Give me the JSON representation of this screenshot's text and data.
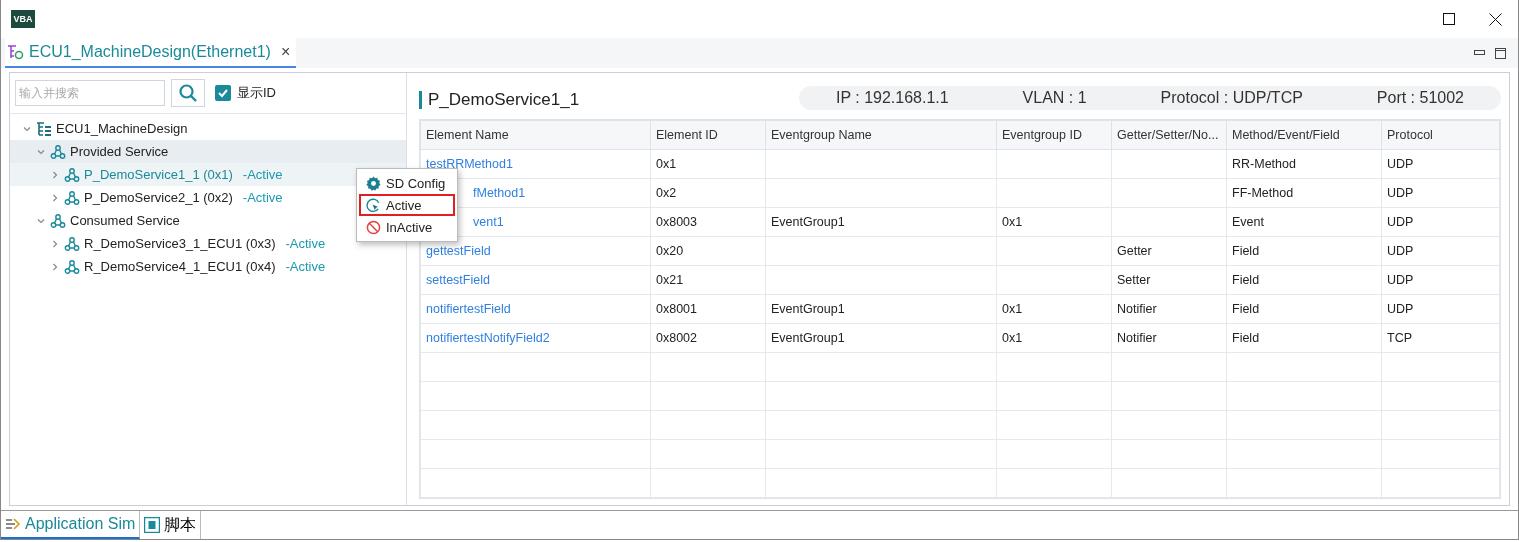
{
  "window": {
    "logo": "VBA"
  },
  "editor_tab": {
    "label": "ECU1_MachineDesign(Ethernet1)",
    "close": "×"
  },
  "search": {
    "placeholder": "输入并搜索"
  },
  "show_id": {
    "label": "显示ID",
    "checked": true
  },
  "tree": [
    {
      "label": "ECU1_MachineDesign",
      "kind": "root",
      "expanded": true,
      "selected": false,
      "highlighted": false,
      "children": [
        {
          "label": "Provided Service",
          "expanded": true,
          "selected": false,
          "highlighted": true,
          "children": [
            {
              "label": "P_DemoService1_1 (0x1)",
              "status": "-Active",
              "expanded": false,
              "selected": true,
              "highlighted": false
            },
            {
              "label": "P_DemoService2_1 (0x2)",
              "status": "-Active",
              "expanded": false,
              "selected": false,
              "highlighted": false
            }
          ]
        },
        {
          "label": "Consumed Service",
          "expanded": true,
          "selected": false,
          "highlighted": false,
          "children": [
            {
              "label": "R_DemoService3_1_ECU1 (0x3)",
              "status": "-Active",
              "expanded": false,
              "selected": false,
              "highlighted": false
            },
            {
              "label": "R_DemoService4_1_ECU1 (0x4)",
              "status": "-Active",
              "expanded": false,
              "selected": false,
              "highlighted": false
            }
          ]
        }
      ]
    }
  ],
  "context_menu": [
    {
      "label": "SD Config",
      "kind": "config",
      "highlighted": false
    },
    {
      "label": "Active",
      "kind": "active",
      "highlighted": true
    },
    {
      "label": "InActive",
      "kind": "inactive",
      "highlighted": false
    }
  ],
  "detail": {
    "title": "P_DemoService1_1",
    "ip": "IP : 192.168.1.1",
    "vlan": "VLAN : 1",
    "protocol": "Protocol : UDP/TCP",
    "port": "Port : 51002"
  },
  "table": {
    "columns": [
      "Element Name",
      "Element ID",
      "Eventgroup Name",
      "Eventgroup ID",
      "Getter/Setter/No...",
      "Method/Event/Field",
      "Protocol"
    ],
    "rows": [
      {
        "covered": false,
        "cells": [
          "testRRMethod1",
          "0x1",
          "",
          "",
          "",
          "RR-Method",
          "UDP"
        ]
      },
      {
        "covered": true,
        "cells": [
          "fMethod1",
          "0x2",
          "",
          "",
          "",
          "FF-Method",
          "UDP"
        ]
      },
      {
        "covered": true,
        "cells": [
          "vent1",
          "0x8003",
          "EventGroup1",
          "0x1",
          "",
          "Event",
          "UDP"
        ]
      },
      {
        "covered": false,
        "cells": [
          "gettestField",
          "0x20",
          "",
          "",
          "Getter",
          "Field",
          "UDP"
        ]
      },
      {
        "covered": false,
        "cells": [
          "settestField",
          "0x21",
          "",
          "",
          "Setter",
          "Field",
          "UDP"
        ]
      },
      {
        "covered": false,
        "cells": [
          "notifiertestField",
          "0x8001",
          "EventGroup1",
          "0x1",
          "Notifier",
          "Field",
          "UDP"
        ]
      },
      {
        "covered": false,
        "cells": [
          "notifiertestNotifyField2",
          "0x8002",
          "EventGroup1",
          "0x1",
          "Notifier",
          "Field",
          "TCP"
        ]
      }
    ]
  },
  "bottom_tabs": [
    {
      "label": "Application Sim",
      "kind": "sim",
      "selected": true
    },
    {
      "label": "脚本",
      "kind": "script",
      "selected": false
    }
  ]
}
